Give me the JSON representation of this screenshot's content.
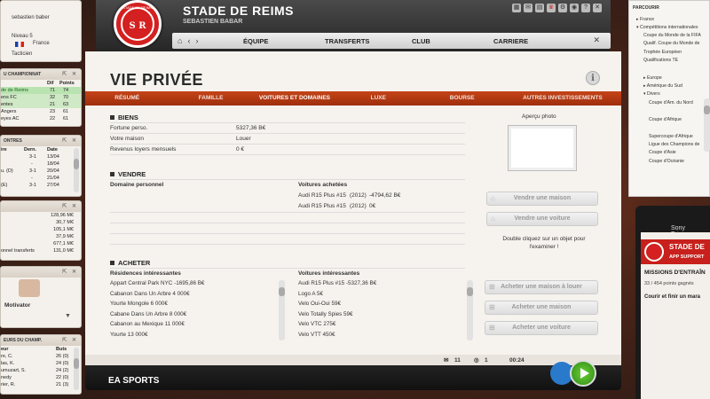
{
  "club": {
    "name": "STADE DE REIMS",
    "manager": "SEBASTIEN BABAR",
    "crest_text": "S R",
    "crest_caption": "STADE DE REIMS"
  },
  "nav": {
    "items": [
      "ÉQUIPE",
      "TRANSFERTS",
      "CLUB",
      "CARRIERE"
    ]
  },
  "page": {
    "title": "VIE PRIVÉE",
    "info": "i"
  },
  "tabs": [
    "RÉSUMÉ",
    "FAMILLE",
    "VOITURES ET DOMAINES",
    "LUXE",
    "BOURSE",
    "AUTRES INVESTISSEMENTS"
  ],
  "biens": {
    "title": "BIENS",
    "rows": [
      {
        "label": "Fortune perso.",
        "value": "5327,36 B€"
      },
      {
        "label": "Votre maison",
        "value": "Louer"
      },
      {
        "label": "Revenus loyers mensuels",
        "value": "0 €"
      }
    ]
  },
  "photo": {
    "label": "Aperçu photo"
  },
  "vendre": {
    "title": "VENDRE",
    "domaine_label": "Domaine personnel",
    "voitures_label": "Voitures achetées",
    "voitures": [
      {
        "name": "Audi R15 Plus #15",
        "year": "(2012)",
        "price": "-4794,62 B€"
      },
      {
        "name": "Audi R15 Plus #15",
        "year": "(2012)",
        "price": "0€"
      }
    ],
    "btn_maison": "Vendre une maison",
    "btn_voiture": "Vendre une voiture",
    "hint": "Double cliquez sur un objet pour l'examiner !"
  },
  "acheter": {
    "title": "ACHETER",
    "res_label": "Résidences intéressantes",
    "residences": [
      "Appart Central Park NYC  -1695,86 B€",
      "Cabanon Dans Un Arbre  4 000€",
      "Yourte Mongole  6 000€",
      "Cabane Dans Un Arbre  8 000€",
      "Cabanon au Mexique  11 000€",
      "Yourte  13 000€"
    ],
    "voit_label": "Voitures intéressantes",
    "voitures": [
      "Audi R15 Plus #15  -5327,36 B€",
      "Logo A  5€",
      "Velo Oui-Oui  59€",
      "Velo Totally Spies  59€",
      "Velo VTC  275€",
      "Velo VTT  450€"
    ],
    "btn_louer": "Acheter une maison à louer",
    "btn_maison": "Acheter une maison",
    "btn_voiture": "Acheter une voiture"
  },
  "statusbar": {
    "mail": "11",
    "support": "1",
    "time": "00:24"
  },
  "footer": {
    "brand": "EA SPORTS"
  },
  "left": {
    "profile": {
      "name": "sebastien baber",
      "level": "Niveau 5",
      "country": "France",
      "role": "Tacticien"
    },
    "championnat": {
      "header": "U CHAMPIONNAT",
      "cols": [
        "Dif",
        "Points"
      ],
      "rows": [
        [
          "de de Reims",
          "71",
          "74"
        ],
        [
          "ens FC",
          "32",
          "70"
        ],
        [
          "entes",
          "21",
          "63"
        ],
        [
          "Angers",
          "23",
          "61"
        ],
        [
          "eyes AC",
          "22",
          "61"
        ]
      ]
    },
    "rencontres": {
      "header": "ONTRES",
      "cols": [
        "ire",
        "Dern.",
        "Date"
      ],
      "rows": [
        [
          "",
          "3-1",
          "13/04"
        ],
        [
          "",
          "-",
          "18/04"
        ],
        [
          "u. (D)",
          "3-1",
          "20/04"
        ],
        [
          "",
          "-",
          "21/04"
        ],
        [
          "(E)",
          "3-1",
          "27/04"
        ]
      ]
    },
    "finances": {
      "rows": [
        "128,96 M€",
        "30,7 M€",
        "105,1 M€",
        "37,9 M€",
        "677,1 M€"
      ],
      "last_label": "onnel transferts",
      "last_value": "131,0 M€"
    },
    "moral": {
      "label": "Motivator"
    },
    "buteurs": {
      "header": "EURS DU CHAMP.",
      "cols": [
        "eur",
        "Buts"
      ],
      "rows": [
        [
          "re, C.",
          "26 (0)"
        ],
        [
          "las, K.",
          "24 (0)"
        ],
        [
          "umuzart, S.",
          "24 (2)"
        ],
        [
          "nedy",
          "22 (0)"
        ],
        [
          "rier, R.",
          "21 (3)"
        ]
      ]
    }
  },
  "right": {
    "title": "PARCOURIR",
    "items": [
      "France",
      "Compétitions internationales",
      "Coupe du Monde de la FIFA",
      "Qualif. Coupe du Monde de",
      "Trophée Européen",
      "Qualifications TE",
      "Europe",
      "Amérique du Sud",
      "Divers",
      "Coupe d'Am. du Nord",
      "Coupe d'Afrique",
      "Supercoupe d'Afrique",
      "Ligue des Champions de",
      "Coupe d'Asie",
      "Coupe d'Océanie"
    ]
  },
  "phone": {
    "brand": "Sony Ericsson",
    "club": "STADE DE",
    "sub": "APP SUPPORT",
    "missions": "MISSIONS D'ENTRAÎN",
    "points": "33 / 454 points gagnés",
    "task": "Courir et finir un mara"
  }
}
